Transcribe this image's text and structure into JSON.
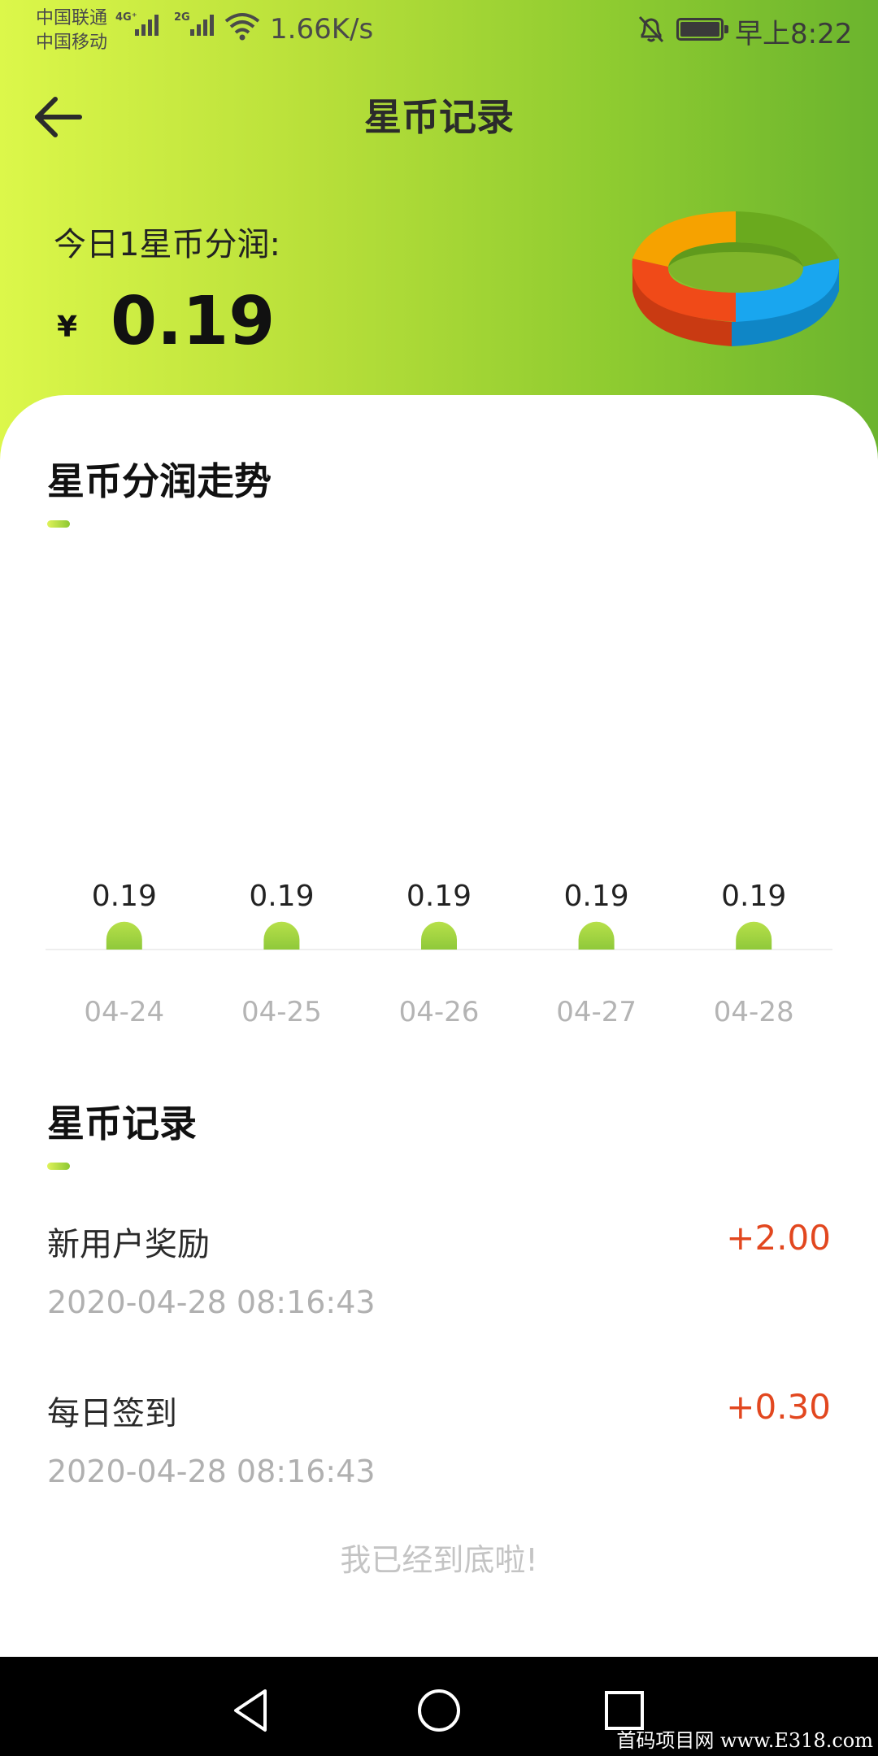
{
  "status_bar": {
    "carrier_1": "中国联通",
    "carrier_2": "中国移动",
    "net_1": "4G⁺",
    "net_2": "2G",
    "speed": "1.66K/s",
    "time": "早上8:22",
    "icons": [
      "signal-icon",
      "wifi-icon",
      "mute-bell-icon",
      "battery-icon"
    ]
  },
  "header": {
    "title": "星币记录",
    "back_icon": "arrow-left-icon",
    "today_label": "今日1星币分润:",
    "currency": "¥",
    "today_value": "0.19",
    "donut_colors": [
      "#6aaa1e",
      "#19a6ef",
      "#f04a18",
      "#f6a200"
    ]
  },
  "trend": {
    "title": "星币分润走势"
  },
  "chart_data": {
    "type": "bar",
    "categories": [
      "04-24",
      "04-25",
      "04-26",
      "04-27",
      "04-28"
    ],
    "values": [
      0.19,
      0.19,
      0.19,
      0.19,
      0.19
    ],
    "data_labels": [
      "0.19",
      "0.19",
      "0.19",
      "0.19",
      "0.19"
    ],
    "title": "",
    "xlabel": "",
    "ylabel": "",
    "grid": false,
    "bar_color": "#8fc93a"
  },
  "records_section": {
    "title": "星币记录",
    "items": [
      {
        "title": "新用户奖励",
        "amount": "+2.00",
        "time": "2020-04-28 08:16:43"
      },
      {
        "title": "每日签到",
        "amount": "+0.30",
        "time": "2020-04-28 08:16:43"
      }
    ],
    "end_note": "我已经到底啦!"
  },
  "nav_bar": {
    "icons": [
      "back-triangle-icon",
      "home-circle-icon",
      "recents-square-icon"
    ],
    "watermark": "首码项目网 www.E318.com"
  }
}
